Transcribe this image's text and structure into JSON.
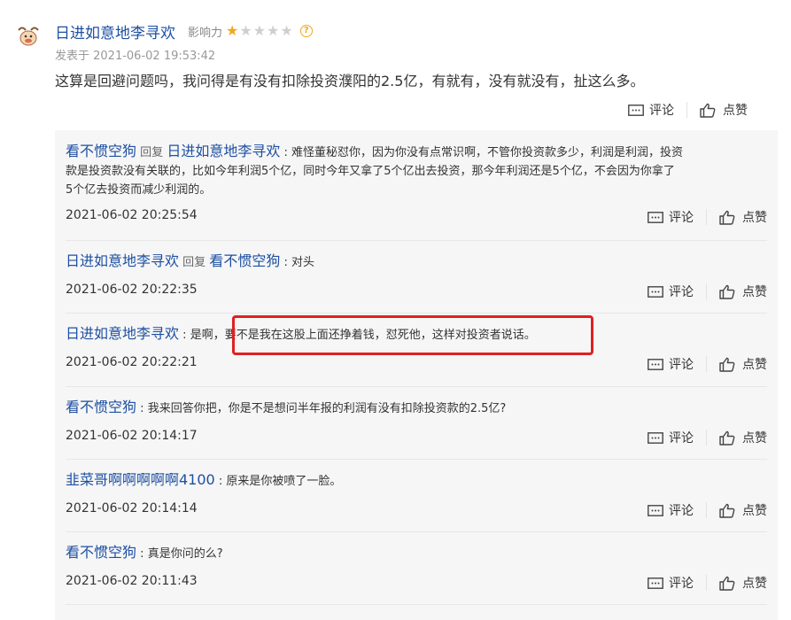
{
  "post": {
    "author": "日进如意地李寻欢",
    "influence_label": "影响力",
    "rating": {
      "filled": 1,
      "total": 5
    },
    "help_icon_text": "?",
    "time": "发表于 2021-06-02 19:53:42",
    "text": "这算是回避问题吗，我问得是有没有扣除投资濮阳的2.5亿，有就有，没有就没有，扯这么多。",
    "comment_label": "评论",
    "like_label": "点赞"
  },
  "reply_word": "回复",
  "replies": [
    {
      "user": "看不惯空狗",
      "reply_to": "日进如意地李寻欢",
      "text_line1": "难怪董秘怼你，因为你没有点常识啊，不管你投资款多少，利润是利润，投资",
      "text_line2": "款是投资款没有关联的，比如今年利润5个亿，同时今年又拿了5个亿出去投资，那今年利润还是5个亿，不会因为你拿了",
      "text_line3": "5个亿去投资而减少利润的。",
      "time": "2021-06-02 20:25:54",
      "comment_label": "评论",
      "like_label": "点赞"
    },
    {
      "user": "日进如意地李寻欢",
      "reply_to": "看不惯空狗",
      "text": "对头",
      "time": "2021-06-02 20:22:35",
      "comment_label": "评论",
      "like_label": "点赞"
    },
    {
      "user": "日进如意地李寻欢",
      "text": "是啊，要不是我在这股上面还挣着钱，怼死他，这样对投资者说话。",
      "time": "2021-06-02 20:22:21",
      "comment_label": "评论",
      "like_label": "点赞"
    },
    {
      "user": "看不惯空狗",
      "text": "我来回答你把，你是不是想问半年报的利润有没有扣除投资款的2.5亿?",
      "time": "2021-06-02 20:14:17",
      "comment_label": "评论",
      "like_label": "点赞"
    },
    {
      "user": "韭菜哥啊啊啊啊啊4100",
      "text": "原来是你被喷了一脸。",
      "time": "2021-06-02 20:14:14",
      "comment_label": "评论",
      "like_label": "点赞"
    },
    {
      "user": "看不惯空狗",
      "text": "真是你问的么?",
      "time": "2021-06-02 20:11:43",
      "comment_label": "评论",
      "like_label": "点赞"
    }
  ],
  "colors": {
    "link_blue": "#1e50a2",
    "star_on": "#f0a81c",
    "star_off": "#cfcfcf",
    "highlight_red": "#e02020",
    "reply_bg": "#f6f6f6"
  },
  "icons": {
    "avatar": "cow-avatar-icon",
    "comment": "comment-icon",
    "like": "thumbs-up-icon",
    "help": "help-icon"
  }
}
